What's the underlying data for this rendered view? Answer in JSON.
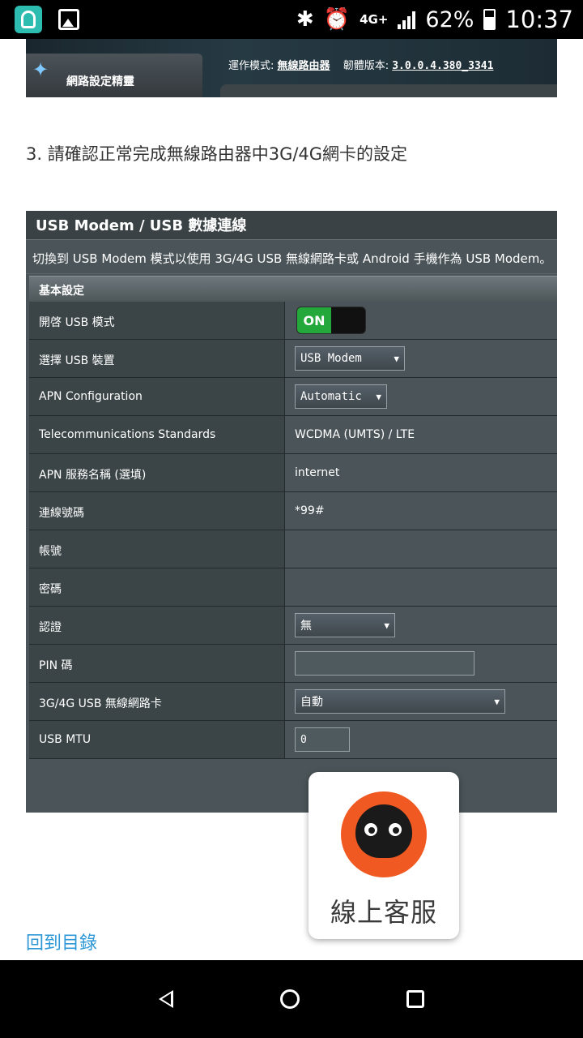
{
  "status_bar": {
    "app_icons": [
      "camera-app-icon",
      "gallery-icon"
    ],
    "network": "4G+",
    "battery": "62%",
    "battery_level": 0.62,
    "time": "10:37"
  },
  "banner": {
    "wizard_label": "網路設定精靈",
    "mode_label": "運作模式:",
    "mode_value": "無線路由器",
    "firmware_label": "韌體版本:",
    "firmware_value": "3.0.0.4.380_3341"
  },
  "step_text": "3. 請確認正常完成無線路由器中3G/4G網卡的設定",
  "panel": {
    "title": "USB Modem / USB 數據連線",
    "description": "切換到 USB Modem 模式以使用 3G/4G USB 無線網路卡或 Android 手機作為 USB Modem。",
    "section": "基本設定",
    "rows": [
      {
        "label": "開啓 USB 模式",
        "toggle": "ON"
      },
      {
        "label": "選擇 USB 裝置",
        "select": "USB Modem"
      },
      {
        "label": "APN Configuration",
        "select": "Automatic"
      },
      {
        "label": "Telecommunications Standards",
        "text": "WCDMA (UMTS) / LTE"
      },
      {
        "label": "APN 服務名稱 (選填)",
        "text": "internet"
      },
      {
        "label": "連線號碼",
        "text": "*99#"
      },
      {
        "label": "帳號",
        "text": ""
      },
      {
        "label": "密碼",
        "text": ""
      },
      {
        "label": "認證",
        "select": "無"
      },
      {
        "label": "PIN 碼",
        "input": ""
      },
      {
        "label": "3G/4G USB 無線網路卡",
        "select": "自動"
      },
      {
        "label": "USB MTU",
        "input": "0"
      }
    ]
  },
  "chat_button": {
    "label": "線上客服"
  },
  "toc_link": "回到目錄",
  "colors": {
    "toggle_on": "#25a83b",
    "link": "#2e98d6",
    "chat_avatar": "#f05a22"
  }
}
